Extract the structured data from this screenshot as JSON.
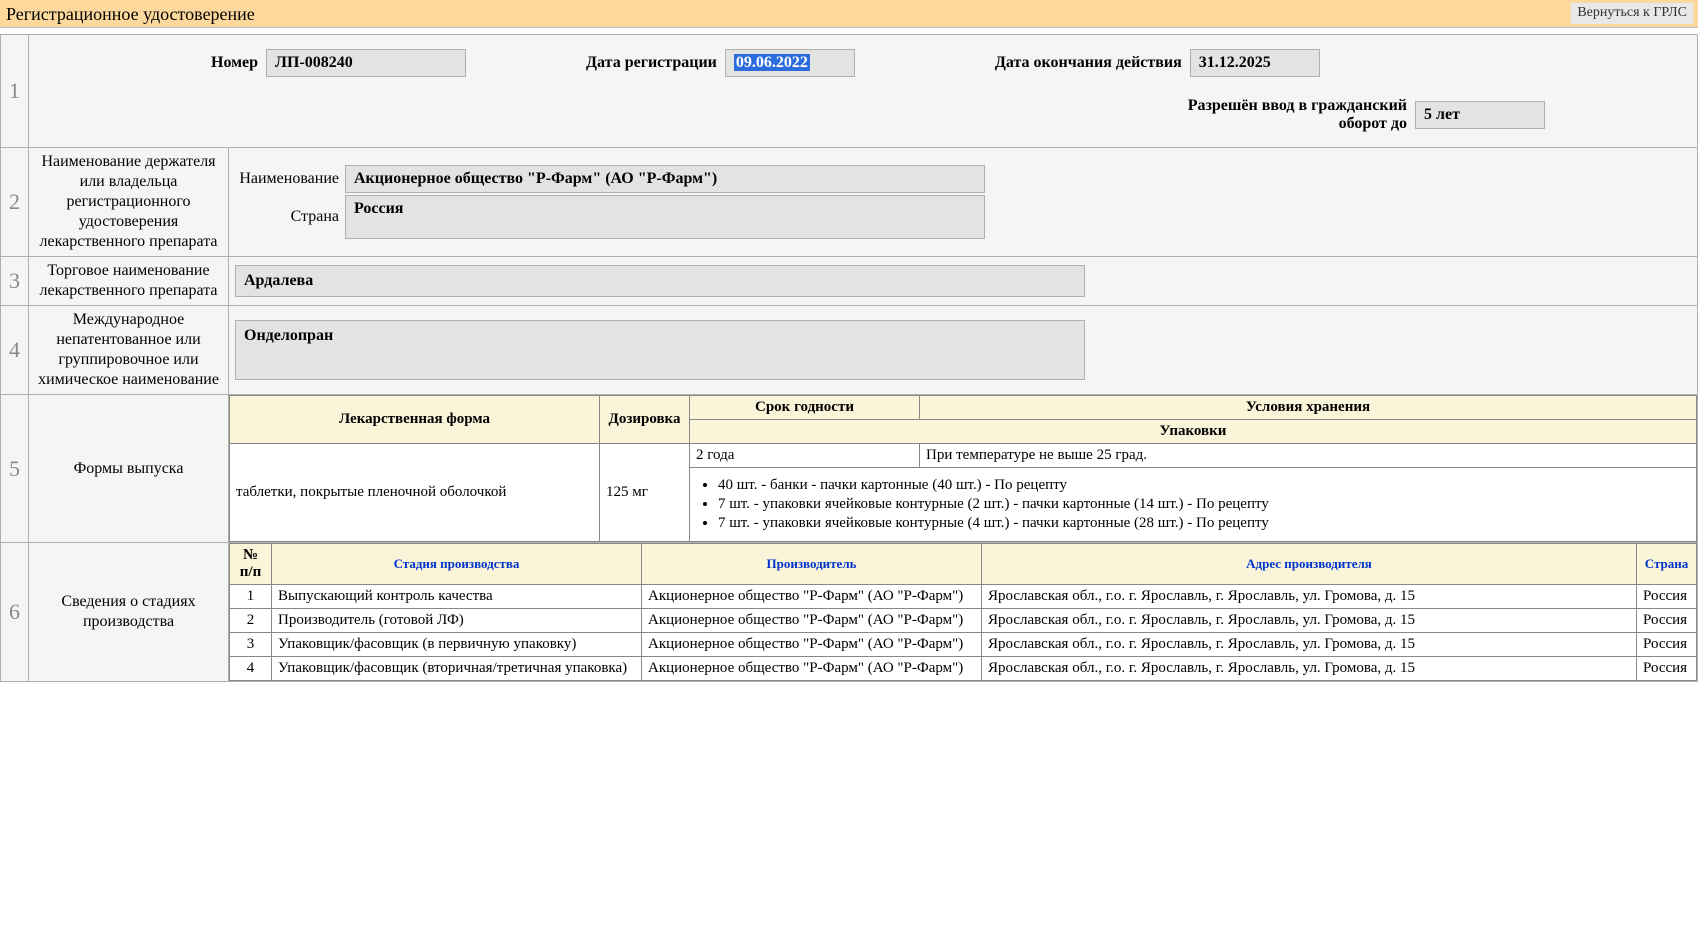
{
  "header": {
    "title": "Регистрационное удостоверение",
    "return_button": "Вернуться к ГРЛС"
  },
  "row1": {
    "number_label": "Номер",
    "number_value": "ЛП-008240",
    "reg_date_label": "Дата регистрации",
    "reg_date_value": "09.06.2022",
    "expiry_label": "Дата окончания действия",
    "expiry_value": "31.12.2025",
    "civil_label": "Разрешён ввод в гражданский оборот до",
    "civil_value": "5 лет"
  },
  "row2": {
    "section_label": "Наименование держателя или владельца регистрационного удостоверения лекарственного препарата",
    "name_label": "Наименование",
    "name_value": "Акционерное общество \"Р-Фарм\" (АО \"Р-Фарм\")",
    "country_label": "Страна",
    "country_value": "Россия"
  },
  "row3": {
    "section_label": "Торговое наименование лекарственного препарата",
    "value": "Ардалева"
  },
  "row4": {
    "section_label": "Международное непатентованное или группировочное или химическое наименование",
    "value": "Онделопран"
  },
  "row5": {
    "section_label": "Формы выпуска",
    "headers": {
      "form": "Лекарственная форма",
      "dose": "Дозировка",
      "shelf": "Срок годности",
      "storage": "Условия хранения",
      "packaging": "Упаковки"
    },
    "form_value": "таблетки, покрытые пленочной оболочкой",
    "dose_value": "125 мг",
    "shelf_value": "2 года",
    "storage_value": "При температуре не выше 25 град.",
    "packages": [
      "40 шт. - банки - пачки картонные (40 шт.) - По рецепту",
      "7 шт. - упаковки ячейковые контурные (2 шт.) - пачки картонные (14 шт.) - По рецепту",
      "7 шт. - упаковки ячейковые контурные (4 шт.) - пачки картонные (28 шт.) - По рецепту"
    ]
  },
  "row6": {
    "section_label": "Сведения о стадиях производства",
    "headers": {
      "num": "№ п/п",
      "stage": "Стадия производства",
      "producer": "Производитель",
      "address": "Адрес производителя",
      "country": "Страна"
    },
    "rows": [
      {
        "n": "1",
        "stage": "Выпускающий контроль качества",
        "producer": "Акционерное общество \"Р-Фарм\" (АО \"Р-Фарм\")",
        "address": "Ярославская обл., г.о. г. Ярославль, г. Ярославль, ул. Громова, д. 15",
        "country": "Россия"
      },
      {
        "n": "2",
        "stage": "Производитель (готовой ЛФ)",
        "producer": "Акционерное общество \"Р-Фарм\" (АО \"Р-Фарм\")",
        "address": "Ярославская обл., г.о. г. Ярославль, г. Ярославль, ул. Громова, д. 15",
        "country": "Россия"
      },
      {
        "n": "3",
        "stage": "Упаковщик/фасовщик (в первичную упаковку)",
        "producer": "Акционерное общество \"Р-Фарм\" (АО \"Р-Фарм\")",
        "address": "Ярославская обл., г.о. г. Ярославль, г. Ярославль, ул. Громова, д. 15",
        "country": "Россия"
      },
      {
        "n": "4",
        "stage": "Упаковщик/фасовщик (вторичная/третичная упаковка)",
        "producer": "Акционерное общество \"Р-Фарм\" (АО \"Р-Фарм\")",
        "address": "Ярославская обл., г.о. г. Ярославль, г. Ярославль, ул. Громова, д. 15",
        "country": "Россия"
      }
    ]
  }
}
